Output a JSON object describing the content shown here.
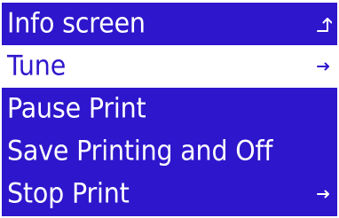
{
  "colors": {
    "background": "#2e16cc",
    "foreground": "#ffffff",
    "selected_background": "#ffffff",
    "selected_foreground": "#2e16cc"
  },
  "menu": {
    "items": [
      {
        "label": "Info screen",
        "icon": "back-arrow-icon",
        "selected": false
      },
      {
        "label": "Tune",
        "icon": "right-arrow-icon",
        "selected": true
      },
      {
        "label": "Pause Print",
        "icon": "",
        "selected": false
      },
      {
        "label": "Save Printing and Off",
        "icon": "",
        "selected": false
      },
      {
        "label": "Stop Print",
        "icon": "right-arrow-icon",
        "selected": false
      }
    ]
  }
}
